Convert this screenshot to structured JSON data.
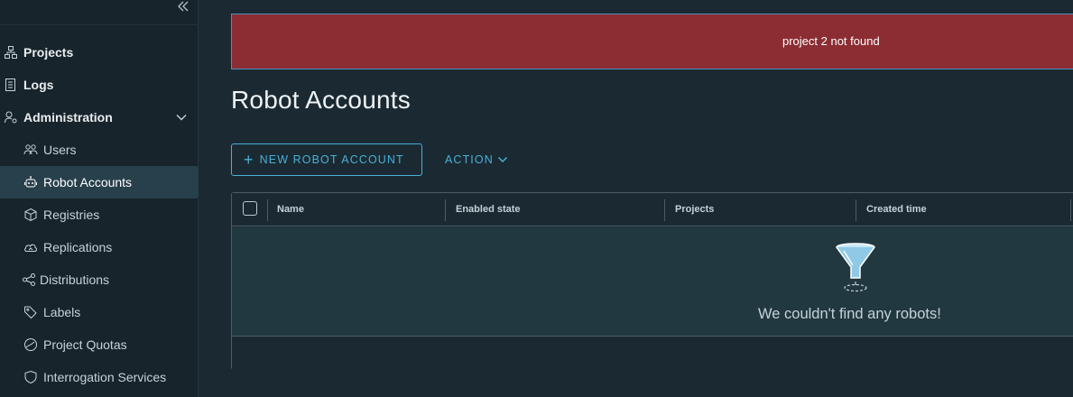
{
  "sidebar": {
    "collapse_icon": "double-chevron-left-icon",
    "items": [
      {
        "label": "Projects",
        "icon": "projects-icon"
      },
      {
        "label": "Logs",
        "icon": "logs-icon"
      },
      {
        "label": "Administration",
        "icon": "administration-icon"
      },
      {
        "label": "Users",
        "icon": "users-icon"
      },
      {
        "label": "Robot Accounts",
        "icon": "robot-icon"
      },
      {
        "label": "Registries",
        "icon": "registries-icon"
      },
      {
        "label": "Replications",
        "icon": "replications-icon"
      },
      {
        "label": "Distributions",
        "icon": "distributions-icon"
      },
      {
        "label": "Labels",
        "icon": "tag-icon"
      },
      {
        "label": "Project Quotas",
        "icon": "quota-icon"
      },
      {
        "label": "Interrogation Services",
        "icon": "shield-icon"
      }
    ],
    "active_item": "Robot Accounts"
  },
  "banner": {
    "message": "project 2 not found",
    "color": "#8b2d33"
  },
  "page": {
    "title": "Robot Accounts"
  },
  "toolbar": {
    "new_label": "NEW ROBOT ACCOUNT",
    "action_label": "ACTION"
  },
  "grid": {
    "columns": [
      "Name",
      "Enabled state",
      "Projects",
      "Created time"
    ],
    "empty_message": "We couldn't find any robots!"
  },
  "colors": {
    "accent": "#49afd9",
    "background": "#1b2a32",
    "sidebar": "#17242b"
  }
}
